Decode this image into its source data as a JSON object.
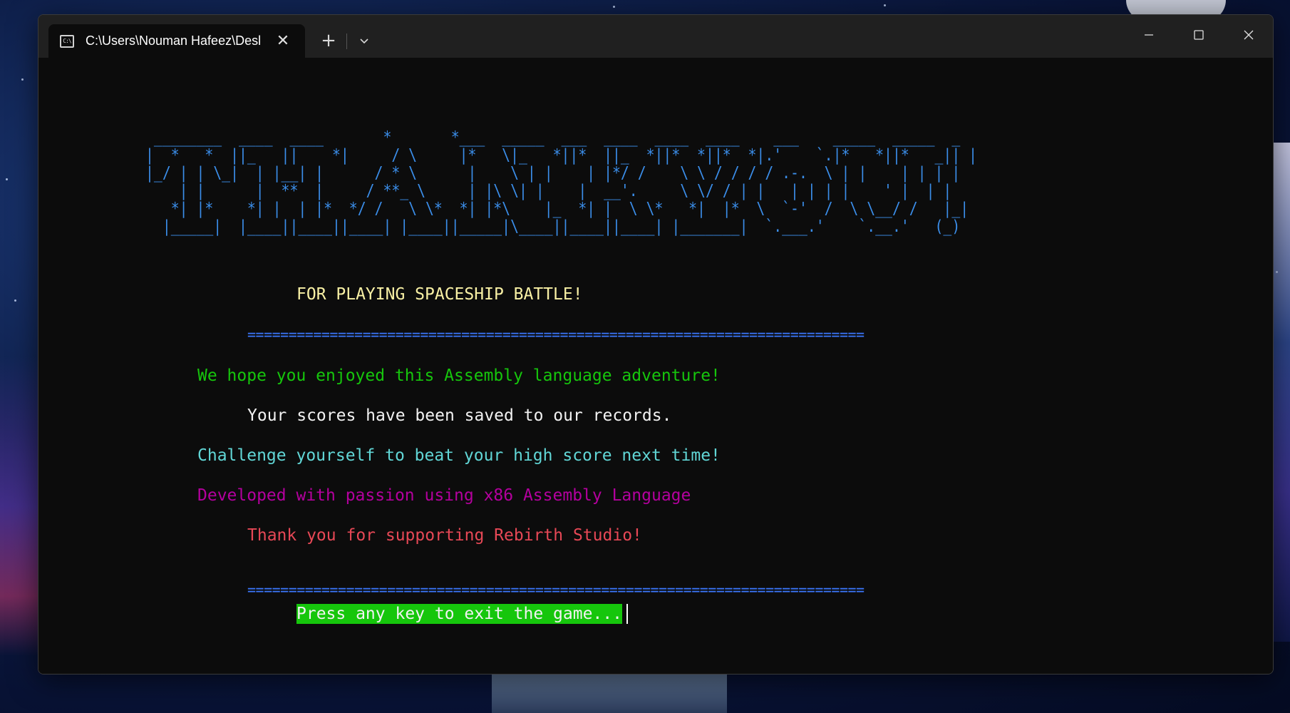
{
  "window": {
    "tab_title": "C:\\Users\\Nouman Hafeez\\Desktop",
    "tab_icon": "terminal-icon",
    "new_tab_label": "+",
    "close_tab_label": "✕"
  },
  "terminal": {
    "ascii_title": " ________  ____  ____       *       *___  _____  ___  ____  ____  ____    ___    _____  _____  _\n|  *   *  ||_   ||    *|     / \\     |*   \\|_   *||*  ||_  *||*  *||*  *|.'    `.|*   *||*   _|| |\n|_/ | | \\_|  | |__| |      / * \\      |    \\ | |    | |*/ /    \\ \\ / / / / .-.  \\ | |    | | | |\n    | |      |  **  |     / **_ \\     | |\\ \\| |    |  __'.     \\ \\/ / | |   | | | |    ' |  | |\n   *| |*    *| |  | |*  */ /   \\ \\*  *| |*\\    |_  *| |  \\ \\*   *|  |*  \\  `-'  /  \\ \\__/ /   |_|\n  |_____|  |____||____||____| |____||_____|\\____||____||____| |_______|  `.___.'    `.__.'   (_)",
    "subtitle": "FOR PLAYING SPACESHIP BATTLE!",
    "separator": "===========================================================================",
    "messages": {
      "enjoyed": "We hope you enjoyed this Assembly language adventure!",
      "saved": "Your scores have been saved to our records.",
      "challenge": "Challenge yourself to beat your high score next time!",
      "developed": "Developed with passion using x86 Assembly Language",
      "thanks": "Thank you for supporting Rebirth Studio!"
    },
    "prompt": "Press any key to exit the game..."
  },
  "colors": {
    "ascii": "#3b8eea",
    "subtitle": "#f9f1a5",
    "separator": "#3b78ff",
    "green": "#16c60c",
    "white": "#f2f2f2",
    "cyan": "#61d6d6",
    "magenta": "#b4009e",
    "red": "#e74856",
    "terminal_bg": "#0c0c0c"
  }
}
